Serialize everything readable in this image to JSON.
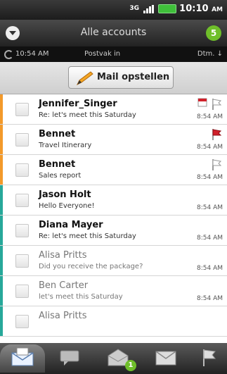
{
  "status_bar": {
    "time": "10:10",
    "ampm": "AM",
    "network": "3G"
  },
  "header": {
    "title": "Alle accounts",
    "unread_count": "5"
  },
  "subbar": {
    "sync_time": "10:54 AM",
    "folder": "Postvak in",
    "sort": "Dtm."
  },
  "compose": {
    "label": "Mail opstellen"
  },
  "colors": {
    "orange_tab": "#f39a2b",
    "teal_tab": "#27a89a",
    "badge_green": "#6fbf2a",
    "flag_red": "#d0202a"
  },
  "messages": [
    {
      "sender": "Jennifer_Singer",
      "subject": "Re: let's meet this Saturday",
      "time": "8:54 AM",
      "read": false,
      "flag": "white",
      "calendar": true,
      "account_color": "orange"
    },
    {
      "sender": "Bennet",
      "subject": "Travel Itinerary",
      "time": "8:54 AM",
      "read": false,
      "flag": "red",
      "calendar": false,
      "account_color": "orange"
    },
    {
      "sender": "Bennet",
      "subject": "Sales report",
      "time": "8:54 AM",
      "read": false,
      "flag": "white",
      "calendar": false,
      "account_color": "orange"
    },
    {
      "sender": "Jason Holt",
      "subject": "Hello Everyone!",
      "time": "8:54 AM",
      "read": false,
      "flag": "none",
      "calendar": false,
      "account_color": "teal"
    },
    {
      "sender": "Diana Mayer",
      "subject": "Re: let's meet this Saturday",
      "time": "8:54 AM",
      "read": false,
      "flag": "none",
      "calendar": false,
      "account_color": "teal"
    },
    {
      "sender": "Alisa Pritts",
      "subject": "Did you receive the package?",
      "time": "8:54 AM",
      "read": true,
      "flag": "none",
      "calendar": false,
      "account_color": "teal"
    },
    {
      "sender": "Ben Carter",
      "subject": "let's meet this Saturday",
      "time": "8:54 AM",
      "read": true,
      "flag": "none",
      "calendar": false,
      "account_color": "teal"
    },
    {
      "sender": "Alisa Pritts",
      "subject": "",
      "time": "",
      "read": true,
      "flag": "none",
      "calendar": false,
      "account_color": "teal"
    }
  ],
  "tabs": [
    {
      "name": "inbox-tab-icon",
      "active": true
    },
    {
      "name": "conversations-tab-icon",
      "active": false
    },
    {
      "name": "unread-tab-icon",
      "active": false,
      "badge": "1"
    },
    {
      "name": "invites-tab-icon",
      "active": false
    },
    {
      "name": "flagged-tab-icon",
      "active": false
    }
  ]
}
